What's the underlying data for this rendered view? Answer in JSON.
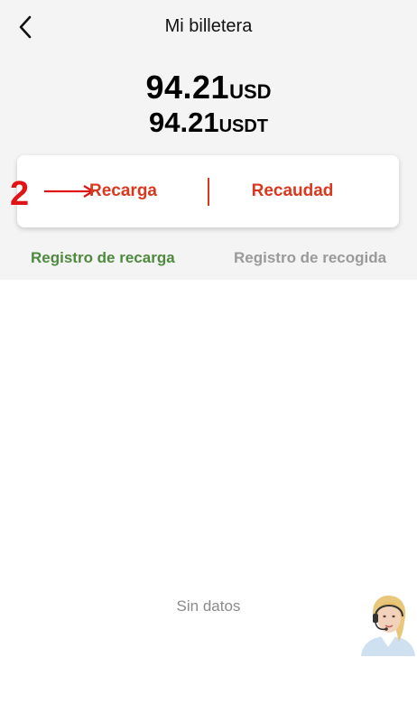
{
  "header": {
    "title": "Mi billetera"
  },
  "balance": {
    "usd_amount": "94.21",
    "usd_unit": "USD",
    "usdt_amount": "94.21",
    "usdt_unit": "USDT"
  },
  "actions": {
    "recharge_label": "Recarga",
    "collect_label": "Recaudad"
  },
  "annotation": {
    "step_number": "2"
  },
  "tabs": [
    {
      "label": "Registro de recarga",
      "active": true
    },
    {
      "label": "Registro de recogida",
      "active": false
    }
  ],
  "empty_state": {
    "text": "Sin datos"
  },
  "colors": {
    "accent": "#d9381e",
    "active_tab": "#4e8a3e",
    "inactive_tab": "#9a9a9a",
    "annotation": "#e01414"
  },
  "icons": {
    "back": "chevron-left-icon",
    "arrow": "arrow-right-icon",
    "support": "customer-support-avatar"
  }
}
